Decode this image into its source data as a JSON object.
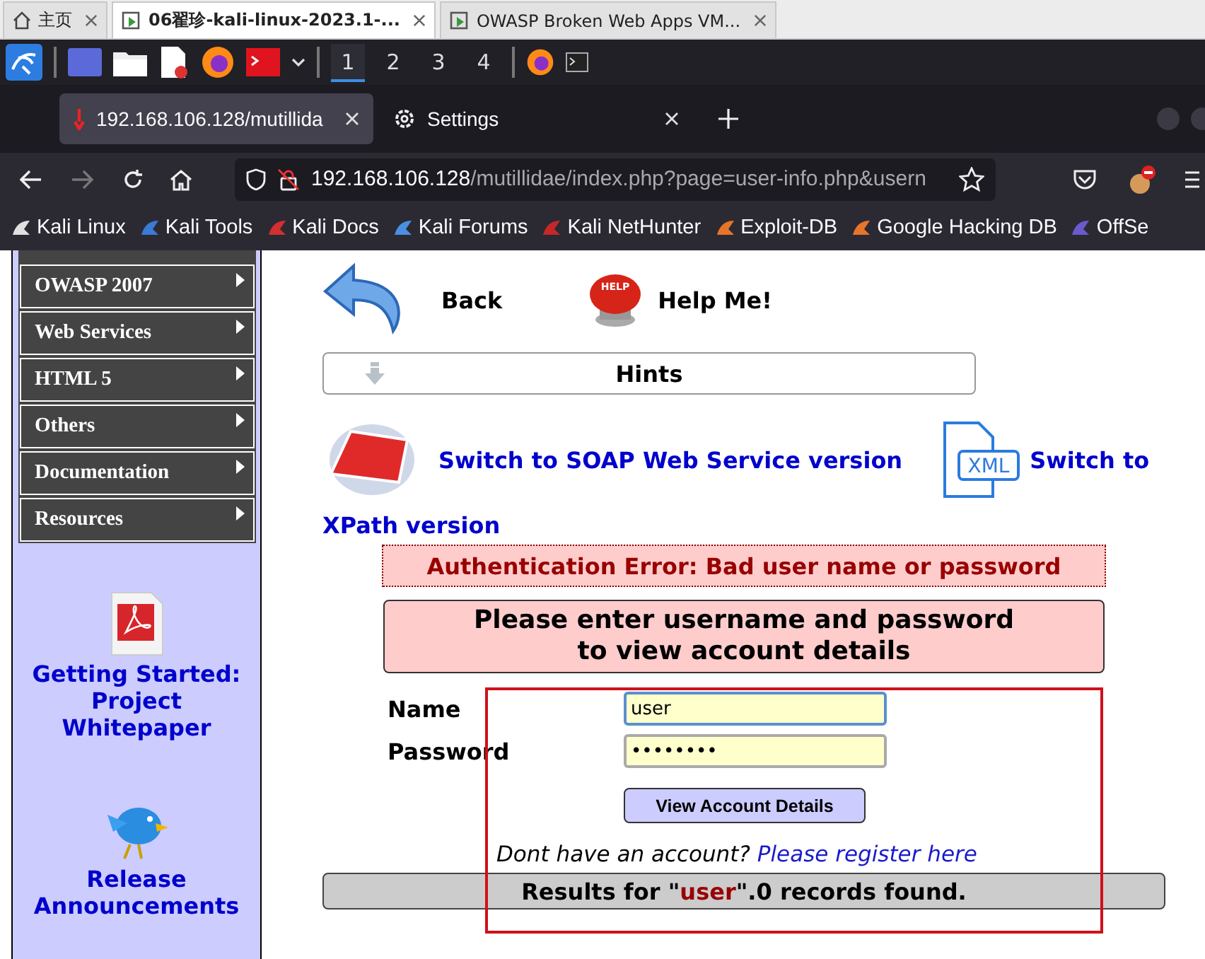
{
  "vm_tabs": [
    {
      "label": "主页",
      "kind": "home",
      "selected": false
    },
    {
      "label": "06翟珍-kali-linux-2023.1-...",
      "kind": "vm",
      "selected": true
    },
    {
      "label": "OWASP Broken Web Apps VM...",
      "kind": "vm",
      "selected": false
    }
  ],
  "taskbar": {
    "workspaces": [
      {
        "label": "1",
        "selected": true
      },
      {
        "label": "2",
        "selected": false
      },
      {
        "label": "3",
        "selected": false
      },
      {
        "label": "4",
        "selected": false
      }
    ]
  },
  "browser_tabs": [
    {
      "label": "192.168.106.128/mutillida",
      "kind": "page",
      "selected": true
    },
    {
      "label": "Settings",
      "kind": "settings",
      "selected": false
    }
  ],
  "address_bar": {
    "host": "192.168.106.128",
    "path": "/mutillidae/index.php?page=user-info.php&usern"
  },
  "bookmarks": [
    {
      "label": "Kali Linux",
      "color": "#e0e0e0"
    },
    {
      "label": "Kali Tools",
      "color": "#3a7bd5"
    },
    {
      "label": "Kali Docs",
      "color": "#d32f2f"
    },
    {
      "label": "Kali Forums",
      "color": "#4a90e2"
    },
    {
      "label": "Kali NetHunter",
      "color": "#c62828"
    },
    {
      "label": "Exploit-DB",
      "color": "#e8742a"
    },
    {
      "label": "Google Hacking DB",
      "color": "#e8742a"
    },
    {
      "label": "OffSe",
      "color": "#6a5acd"
    }
  ],
  "sidebar": {
    "menu": [
      {
        "label": "OWASP 2007"
      },
      {
        "label": "Web Services"
      },
      {
        "label": "HTML 5"
      },
      {
        "label": "Others"
      },
      {
        "label": "Documentation"
      },
      {
        "label": "Resources"
      }
    ],
    "links": [
      {
        "label": "Getting Started: Project Whitepaper",
        "kind": "pdf"
      },
      {
        "label": "Release Announcements",
        "kind": "bird"
      }
    ]
  },
  "toolbar": {
    "back": "Back",
    "help": "Help Me!",
    "help_icon_label": "HELP"
  },
  "hints": "Hints",
  "switch_links": [
    {
      "label": "Switch to SOAP Web Service version",
      "kind": "ajax"
    },
    {
      "label": "Switch to",
      "continuation": "XPath version",
      "kind": "xml",
      "icon_label": "XML"
    }
  ],
  "error": "Authentication Error: Bad user name or password",
  "instructions": "Please enter username and password\nto view account details",
  "form": {
    "name_label": "Name",
    "name_value": "user",
    "password_label": "Password",
    "password_value": "••••••••",
    "submit": "View Account Details",
    "register_prompt": "Dont have an account?",
    "register_link": "Please register here"
  },
  "results": {
    "prefix": "Results for \"",
    "query": "user",
    "suffix": "\".0 records found."
  }
}
